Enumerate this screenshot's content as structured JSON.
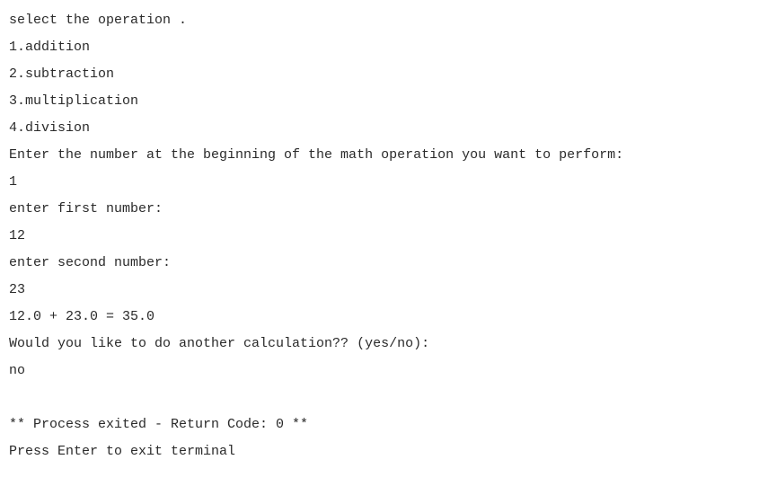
{
  "terminal": {
    "lines": [
      "select the operation .",
      "1.addition",
      "2.subtraction",
      "3.multiplication",
      "4.division",
      "Enter the number at the beginning of the math operation you want to perform:",
      "1",
      "enter first number:",
      "12",
      "enter second number:",
      "23",
      "12.0 + 23.0 = 35.0",
      "Would you like to do another calculation?? (yes/no):",
      "no",
      "",
      "",
      "** Process exited - Return Code: 0 **",
      "Press Enter to exit terminal"
    ]
  }
}
